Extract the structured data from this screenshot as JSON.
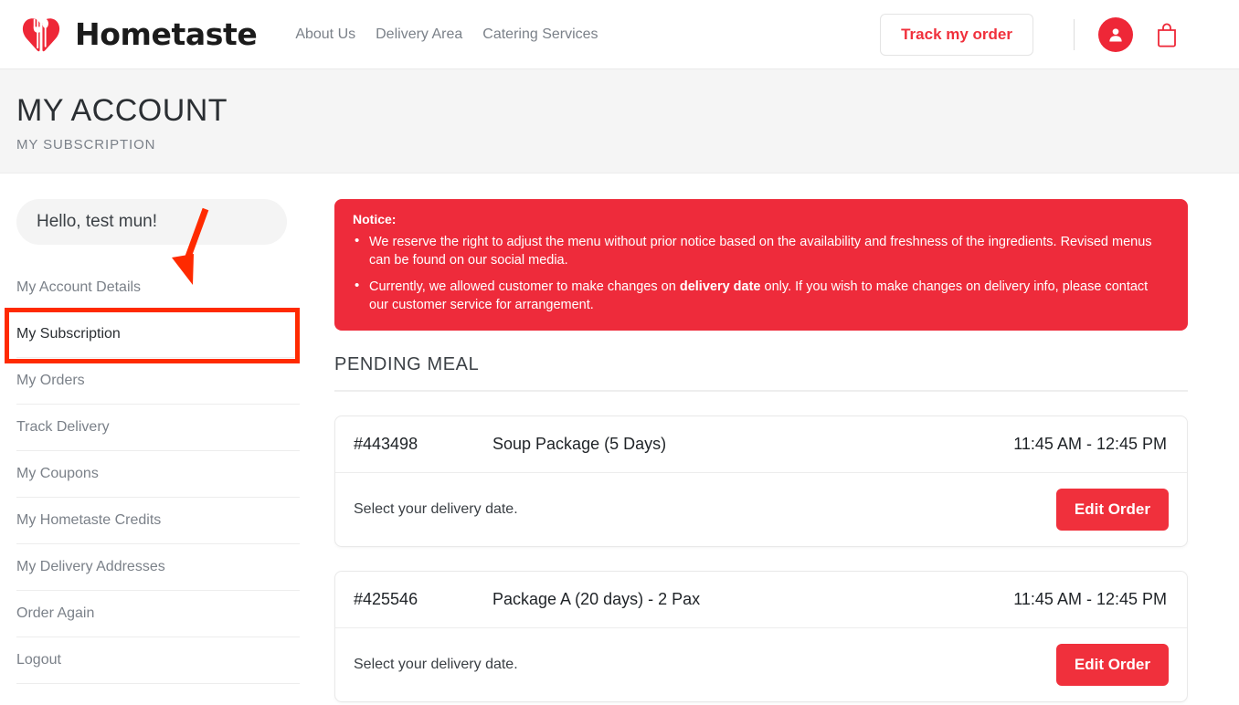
{
  "header": {
    "brand_name": "Hometaste",
    "logo_icon": "heart-fork-spoon-logo",
    "nav": [
      {
        "label": "About Us"
      },
      {
        "label": "Delivery Area"
      },
      {
        "label": "Catering Services"
      }
    ],
    "track_button": "Track my order",
    "account_icon": "user-avatar-icon",
    "cart_icon": "shopping-bag-icon"
  },
  "page": {
    "title": "MY ACCOUNT",
    "subtitle": "MY SUBSCRIPTION"
  },
  "sidebar": {
    "greeting": "Hello, test mun!",
    "items": [
      {
        "label": "My Account Details"
      },
      {
        "label": "My Subscription"
      },
      {
        "label": "My Orders"
      },
      {
        "label": "Track Delivery"
      },
      {
        "label": "My Coupons"
      },
      {
        "label": "My Hometaste Credits"
      },
      {
        "label": "My Delivery Addresses"
      },
      {
        "label": "Order Again"
      },
      {
        "label": "Logout"
      }
    ]
  },
  "annotation": {
    "highlight_color": "#ff2a00",
    "arrow_icon": "red-arrow-pointing-down-left",
    "target_label": "My Subscription"
  },
  "notice": {
    "title": "Notice:",
    "bullets": [
      {
        "pre": "We reserve the right to adjust the menu without prior notice based on the availability and freshness of the ingredients. Revised menus can be found on our social media.",
        "bold": "",
        "post": ""
      },
      {
        "pre": "Currently, we allowed customer to make changes on ",
        "bold": "delivery date",
        "post": " only. If you wish to make changes on delivery info, please contact our customer service for arrangement."
      }
    ],
    "background_color": "#ee2b3b"
  },
  "main": {
    "section_title": "PENDING MEAL",
    "orders": [
      {
        "id": "#443498",
        "package": "Soup Package (5 Days)",
        "time": "11:45 AM - 12:45 PM",
        "note": "Select your delivery date.",
        "action": "Edit Order"
      },
      {
        "id": "#425546",
        "package": "Package A (20 days) - 2 Pax",
        "time": "11:45 AM - 12:45 PM",
        "note": "Select your delivery date.",
        "action": "Edit Order"
      }
    ]
  },
  "colors": {
    "brand_red": "#ee2737",
    "button_red": "#f0303c",
    "notice_red": "#ee2b3b",
    "annotation_red": "#ff2a00",
    "title_band_bg": "#f5f5f5"
  }
}
